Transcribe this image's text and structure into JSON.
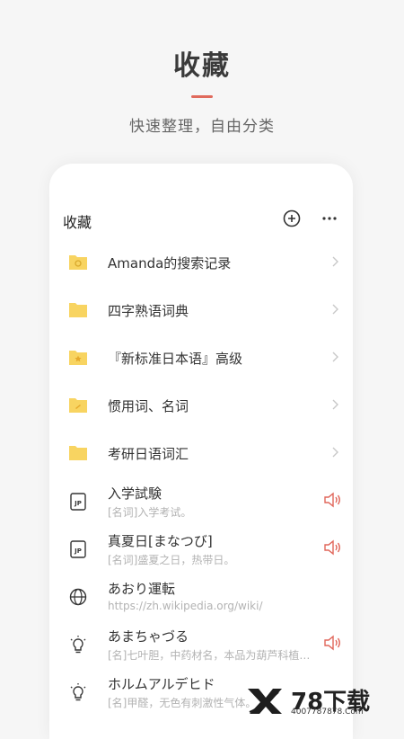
{
  "promo": {
    "title": "收藏",
    "subtitle": "快速整理，自由分类"
  },
  "header": {
    "title": "收藏",
    "add_icon": "plus-circle-icon",
    "more_icon": "more-horizontal-icon"
  },
  "colors": {
    "accent": "#e06a5c",
    "folder": "#f8d461",
    "speaker": "#e0665a"
  },
  "folders": [
    {
      "label": "Amanda的搜索记录",
      "icon": "folder-search-icon"
    },
    {
      "label": "四字熟语词典",
      "icon": "folder-icon"
    },
    {
      "label": "『新标准日本语』高级",
      "icon": "folder-star-icon"
    },
    {
      "label": "惯用词、名词",
      "icon": "folder-note-icon"
    },
    {
      "label": "考研日语词汇",
      "icon": "folder-icon"
    }
  ],
  "words": [
    {
      "title": "入学試験",
      "subtitle": "[名词]入学考试。",
      "icon": "jp-dictionary-icon",
      "audio": true
    },
    {
      "title": "真夏日[まなつび]",
      "subtitle": "[名词]盛夏之日，热带日。",
      "icon": "jp-dictionary-icon",
      "audio": true
    },
    {
      "title": "あおり運転",
      "subtitle": "https://zh.wikipedia.org/wiki/",
      "icon": "globe-icon",
      "audio": false
    },
    {
      "title": "あまちゃづる",
      "subtitle": "[名]七叶胆，中药材名，本品为葫芦科植物…",
      "icon": "lightbulb-icon",
      "audio": true
    },
    {
      "title": "ホルムアルデヒド",
      "subtitle": "[名]甲醛，无色有刺激性气体。",
      "icon": "lightbulb-icon",
      "audio": false
    }
  ],
  "watermark": {
    "brand": "78下载",
    "phone": "4007787878.Com"
  }
}
